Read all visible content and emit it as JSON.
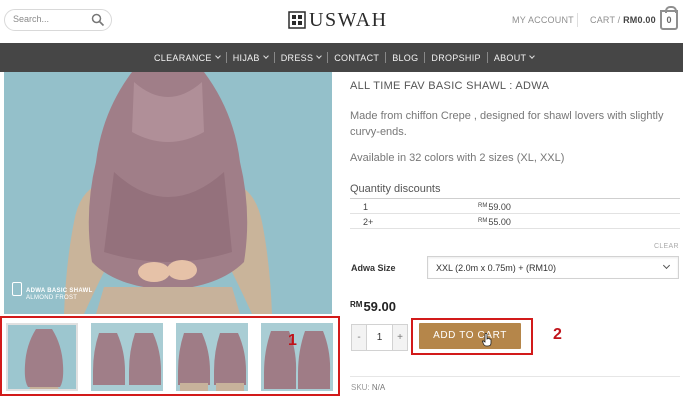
{
  "header": {
    "search_placeholder": "Search...",
    "logo_text": "USWAH",
    "my_account": "MY ACCOUNT",
    "cart_label": "CART /",
    "cart_amount": "RM0.00",
    "cart_count": "0"
  },
  "nav": {
    "items": [
      {
        "label": "CLEARANCE",
        "dropdown": true
      },
      {
        "label": "HIJAB",
        "dropdown": true
      },
      {
        "label": "DRESS",
        "dropdown": true
      },
      {
        "label": "CONTACT",
        "dropdown": false
      },
      {
        "label": "BLOG",
        "dropdown": false
      },
      {
        "label": "DROPSHIP",
        "dropdown": false
      },
      {
        "label": "ABOUT",
        "dropdown": true
      }
    ]
  },
  "image": {
    "caption_line1": "ADWA BASIC SHAWL",
    "caption_line2": "ALMOND FROST"
  },
  "product": {
    "title": "ALL TIME FAV BASIC SHAWL : ADWA",
    "description": "Made from chiffon Crepe , designed for shawl lovers with slightly curvy-ends.",
    "availability": "Available in 32 colors with 2 sizes (XL, XXL)",
    "quantity_discounts_title": "Quantity discounts",
    "discounts": [
      {
        "qty": "1",
        "currency": "RM",
        "price": "59.00"
      },
      {
        "qty": "2+",
        "currency": "RM",
        "price": "55.00"
      }
    ],
    "clear_label": "CLEAR",
    "size_label": "Adwa Size",
    "size_selected": "XXL (2.0m x 0.75m) + (RM10)",
    "price_currency": "RM",
    "price_value": "59.00",
    "qty_minus": "-",
    "qty_value": "1",
    "qty_plus": "+",
    "add_to_cart": "ADD TO CART",
    "sku_label": "SKU:",
    "sku_value": "N/A"
  },
  "annotations": {
    "thumbs_marker": "1",
    "cart_marker": "2",
    "highlight_color": "#d21a1a"
  },
  "colors": {
    "nav_bg": "#464646",
    "button_bg": "#b5864a",
    "image_bg": "#8fbcc7",
    "shawl": "#a07e88"
  }
}
